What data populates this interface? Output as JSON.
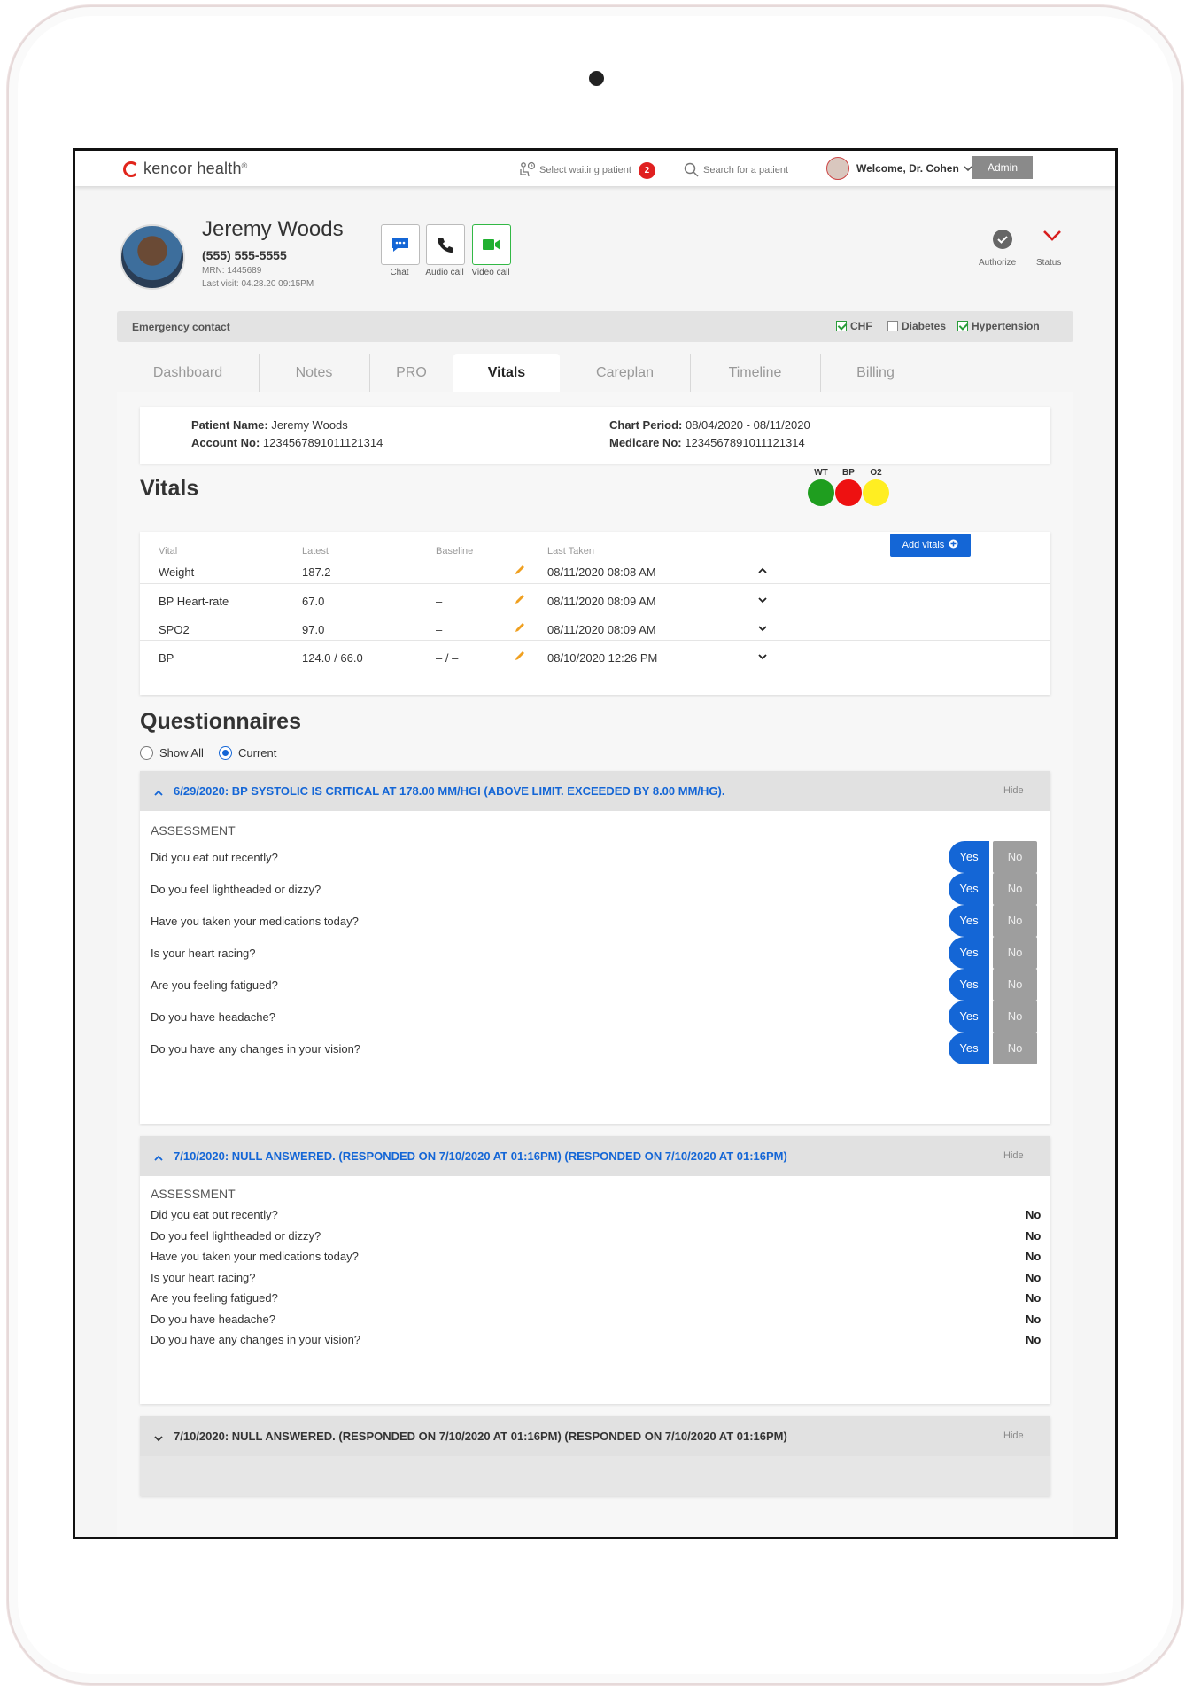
{
  "header": {
    "brand": "kencor health",
    "brand_mark": "®",
    "waiting_label": "Select waiting patient",
    "waiting_count": "2",
    "search_label": "Search for a patient",
    "welcome": "Welcome, Dr. Cohen",
    "admin": "Admin"
  },
  "patient": {
    "name": "Jeremy Woods",
    "phone": "(555) 555-5555",
    "mrn": "MRN: 1445689",
    "last_visit": "Last visit: 04.28.20 09:15PM",
    "actions": [
      {
        "label": "Chat"
      },
      {
        "label": "Audio call"
      },
      {
        "label": "Video call"
      }
    ],
    "authorize": "Authorize",
    "status": "Status"
  },
  "emergency": {
    "label": "Emergency contact",
    "conditions": [
      {
        "label": "CHF",
        "checked": true
      },
      {
        "label": "Diabetes",
        "checked": false
      },
      {
        "label": "Hypertension",
        "checked": true
      }
    ]
  },
  "tabs": [
    "Dashboard",
    "Notes",
    "PRO",
    "Vitals",
    "Careplan",
    "Timeline",
    "Billing"
  ],
  "active_tab": "Vitals",
  "info": {
    "patient_name_label": "Patient Name:",
    "patient_name": "Jeremy Woods",
    "account_label": "Account No:",
    "account": "1234567891011121314",
    "chart_period_label": "Chart Period:",
    "chart_period": "08/04/2020 - 08/11/2020",
    "medicare_label": "Medicare No:",
    "medicare": "1234567891011121314"
  },
  "vitals": {
    "title": "Vitals",
    "indicators": [
      {
        "label": "WT",
        "color": "#1f9e1f"
      },
      {
        "label": "BP",
        "color": "#ee1111"
      },
      {
        "label": "O2",
        "color": "#ffee22"
      }
    ],
    "columns": [
      "Vital",
      "Latest",
      "Baseline",
      "Last Taken"
    ],
    "add_label": "Add vitals",
    "rows": [
      {
        "vital": "Weight",
        "latest": "187.2",
        "baseline": "–",
        "taken": "08/11/2020 08:08 AM"
      },
      {
        "vital": "BP Heart-rate",
        "latest": "67.0",
        "baseline": "–",
        "taken": "08/11/2020 08:09 AM"
      },
      {
        "vital": "SPO2",
        "latest": "97.0",
        "baseline": "–",
        "taken": "08/11/2020 08:09 AM"
      },
      {
        "vital": "BP",
        "latest": "124.0 / 66.0",
        "baseline": "– / –",
        "taken": "08/10/2020 12:26 PM"
      }
    ]
  },
  "questionnaires": {
    "title": "Questionnaires",
    "show_all": "Show All",
    "current": "Current",
    "hide_label": "Hide",
    "assessment_label": "ASSESSMENT",
    "yes_label": "Yes",
    "no_label": "No",
    "questions": [
      "Did you eat out recently?",
      "Do you feel lightheaded or dizzy?",
      "Have you taken your medications today?",
      "Is your heart racing?",
      "Are you feeling fatigued?",
      "Do you have headache?",
      "Do you have any changes in your vision?"
    ],
    "cards": [
      {
        "title": "6/29/2020: BP SYSTOLIC IS CRITICAL AT 178.00 MM/HGI (ABOVE LIMIT. EXCEEDED BY 8.00 MM/HG)."
      },
      {
        "title": "7/10/2020: NULL ANSWERED. (RESPONDED ON 7/10/2020 AT 01:16PM) (RESPONDED ON 7/10/2020 AT 01:16PM)"
      },
      {
        "title": "7/10/2020: NULL ANSWERED. (RESPONDED ON 7/10/2020 AT 01:16PM) (RESPONDED ON 7/10/2020 AT 01:16PM)"
      }
    ]
  }
}
